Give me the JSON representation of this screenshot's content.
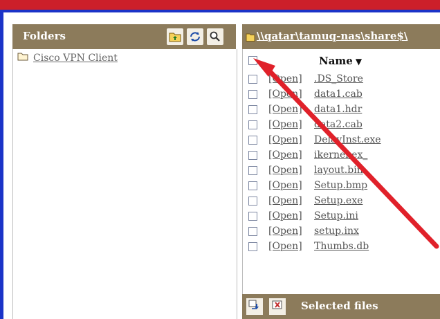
{
  "folders": {
    "title": "Folders",
    "items": [
      {
        "label": "Cisco VPN Client"
      }
    ],
    "tools": {
      "up_icon": "folder-up-icon",
      "refresh_icon": "refresh-icon",
      "search_icon": "search-icon"
    }
  },
  "files": {
    "path": "\\\\qatar\\tamuq-nas\\share$\\",
    "name_column": "Name",
    "open_label": "[Open]",
    "rows": [
      {
        "name": ".DS_Store"
      },
      {
        "name": "data1.cab"
      },
      {
        "name": "data1.hdr"
      },
      {
        "name": "data2.cab"
      },
      {
        "name": "DelayInst.exe"
      },
      {
        "name": "ikernel.ex_"
      },
      {
        "name": "layout.bin"
      },
      {
        "name": "Setup.bmp"
      },
      {
        "name": "Setup.exe"
      },
      {
        "name": "Setup.ini"
      },
      {
        "name": "setup.inx"
      },
      {
        "name": "Thumbs.db"
      }
    ],
    "bottom": {
      "label": "Selected files",
      "download_icon": "download-icon",
      "delete_icon": "delete-icon"
    }
  },
  "colors": {
    "top_bar_red": "#cc1f2a",
    "top_bar_blue": "#1b33c8",
    "panel_header": "#8c7b5b",
    "annotation_arrow": "#e0212a"
  }
}
